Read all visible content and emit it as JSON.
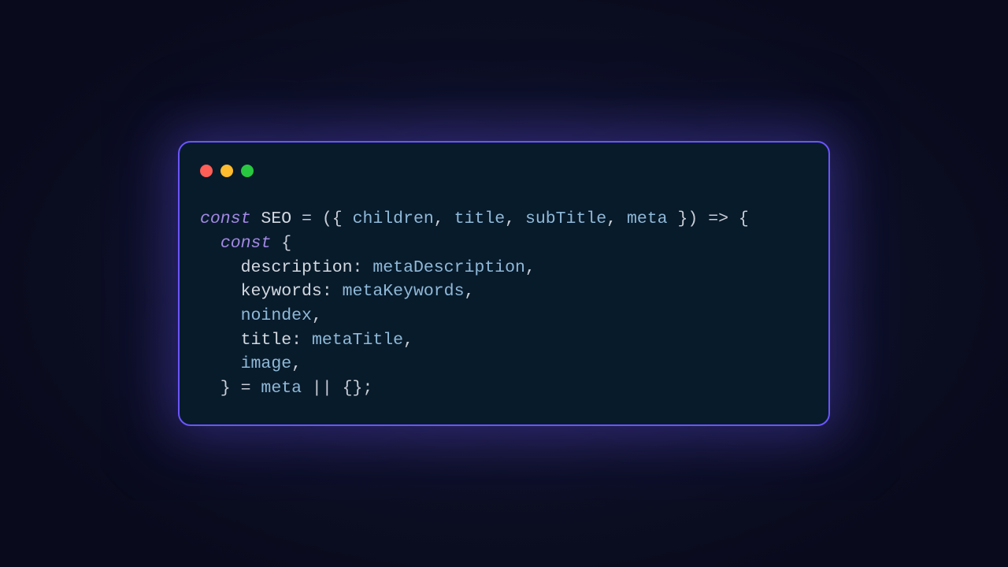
{
  "dots": {
    "red": "#ff5f57",
    "yellow": "#febc2e",
    "green": "#28c840"
  },
  "border_color": "#6a55ff",
  "bg_color": "#081b2b",
  "code": {
    "kw_const": "const",
    "seo": "SEO",
    "eq": " = ",
    "lparen": "(",
    "lbrace_d": "{ ",
    "children": "children",
    "comma": ", ",
    "title_p": "title",
    "subTitle": "subTitle",
    "meta_p": "meta",
    "rbrace_d": " }",
    "rparen": ")",
    "arrow": " => ",
    "lbrace": "{",
    "rbrace": "}",
    "indent1": "  ",
    "indent2": "    ",
    "description": "description",
    "colon": ": ",
    "metaDescription": "metaDescription",
    "comma_t": ",",
    "keywords": "keywords",
    "metaKeywords": "metaKeywords",
    "noindex": "noindex",
    "title_k": "title",
    "metaTitle": "metaTitle",
    "image": "image",
    "close_destr": "  } = ",
    "meta_v": "meta",
    "or": " || ",
    "empty": "{}",
    "semi": ";"
  }
}
